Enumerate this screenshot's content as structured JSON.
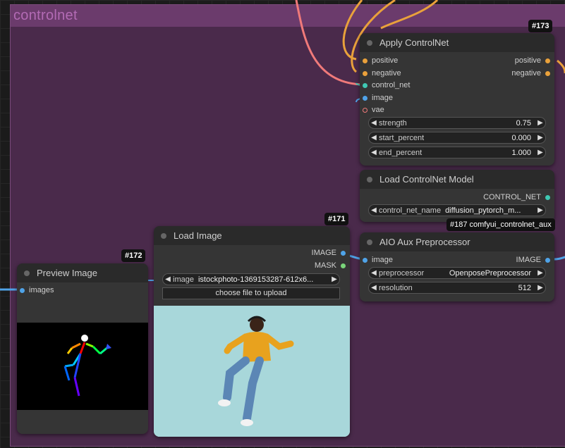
{
  "group": {
    "title": "controlnet"
  },
  "colors": {
    "group_bg": "#4a2a4b",
    "group_header": "#6b3b6c",
    "node_bg": "#353535",
    "wire_orange": "#e9a13b",
    "wire_pink": "#f07a7a",
    "wire_blue": "#4fa3e8",
    "wire_teal": "#3fc9b3"
  },
  "apply_controlnet": {
    "id": "#173",
    "title": "Apply ControlNet",
    "inputs": [
      "positive",
      "negative",
      "control_net",
      "image",
      "vae"
    ],
    "outputs": [
      "positive",
      "negative"
    ],
    "widgets": [
      {
        "label": "strength",
        "value": "0.75"
      },
      {
        "label": "start_percent",
        "value": "0.000"
      },
      {
        "label": "end_percent",
        "value": "1.000"
      }
    ]
  },
  "load_controlnet": {
    "title": "Load ControlNet Model",
    "output": "CONTROL_NET",
    "widget": {
      "label": "control_net_name",
      "value": "diffusion_pytorch_m..."
    },
    "tooltip": "#187 comfyui_controlnet_aux"
  },
  "aio_aux": {
    "title": "AIO Aux Preprocessor",
    "input": "image",
    "output": "IMAGE",
    "widgets": [
      {
        "label": "preprocessor",
        "value": "OpenposePreprocessor"
      },
      {
        "label": "resolution",
        "value": "512"
      }
    ]
  },
  "load_image": {
    "id": "#171",
    "title": "Load Image",
    "outputs": [
      "IMAGE",
      "MASK"
    ],
    "widget": {
      "label": "image",
      "value": "istockphoto-1369153287-612x6..."
    },
    "upload_label": "choose file to upload"
  },
  "preview_image": {
    "id": "#172",
    "title": "Preview Image",
    "input": "images"
  }
}
